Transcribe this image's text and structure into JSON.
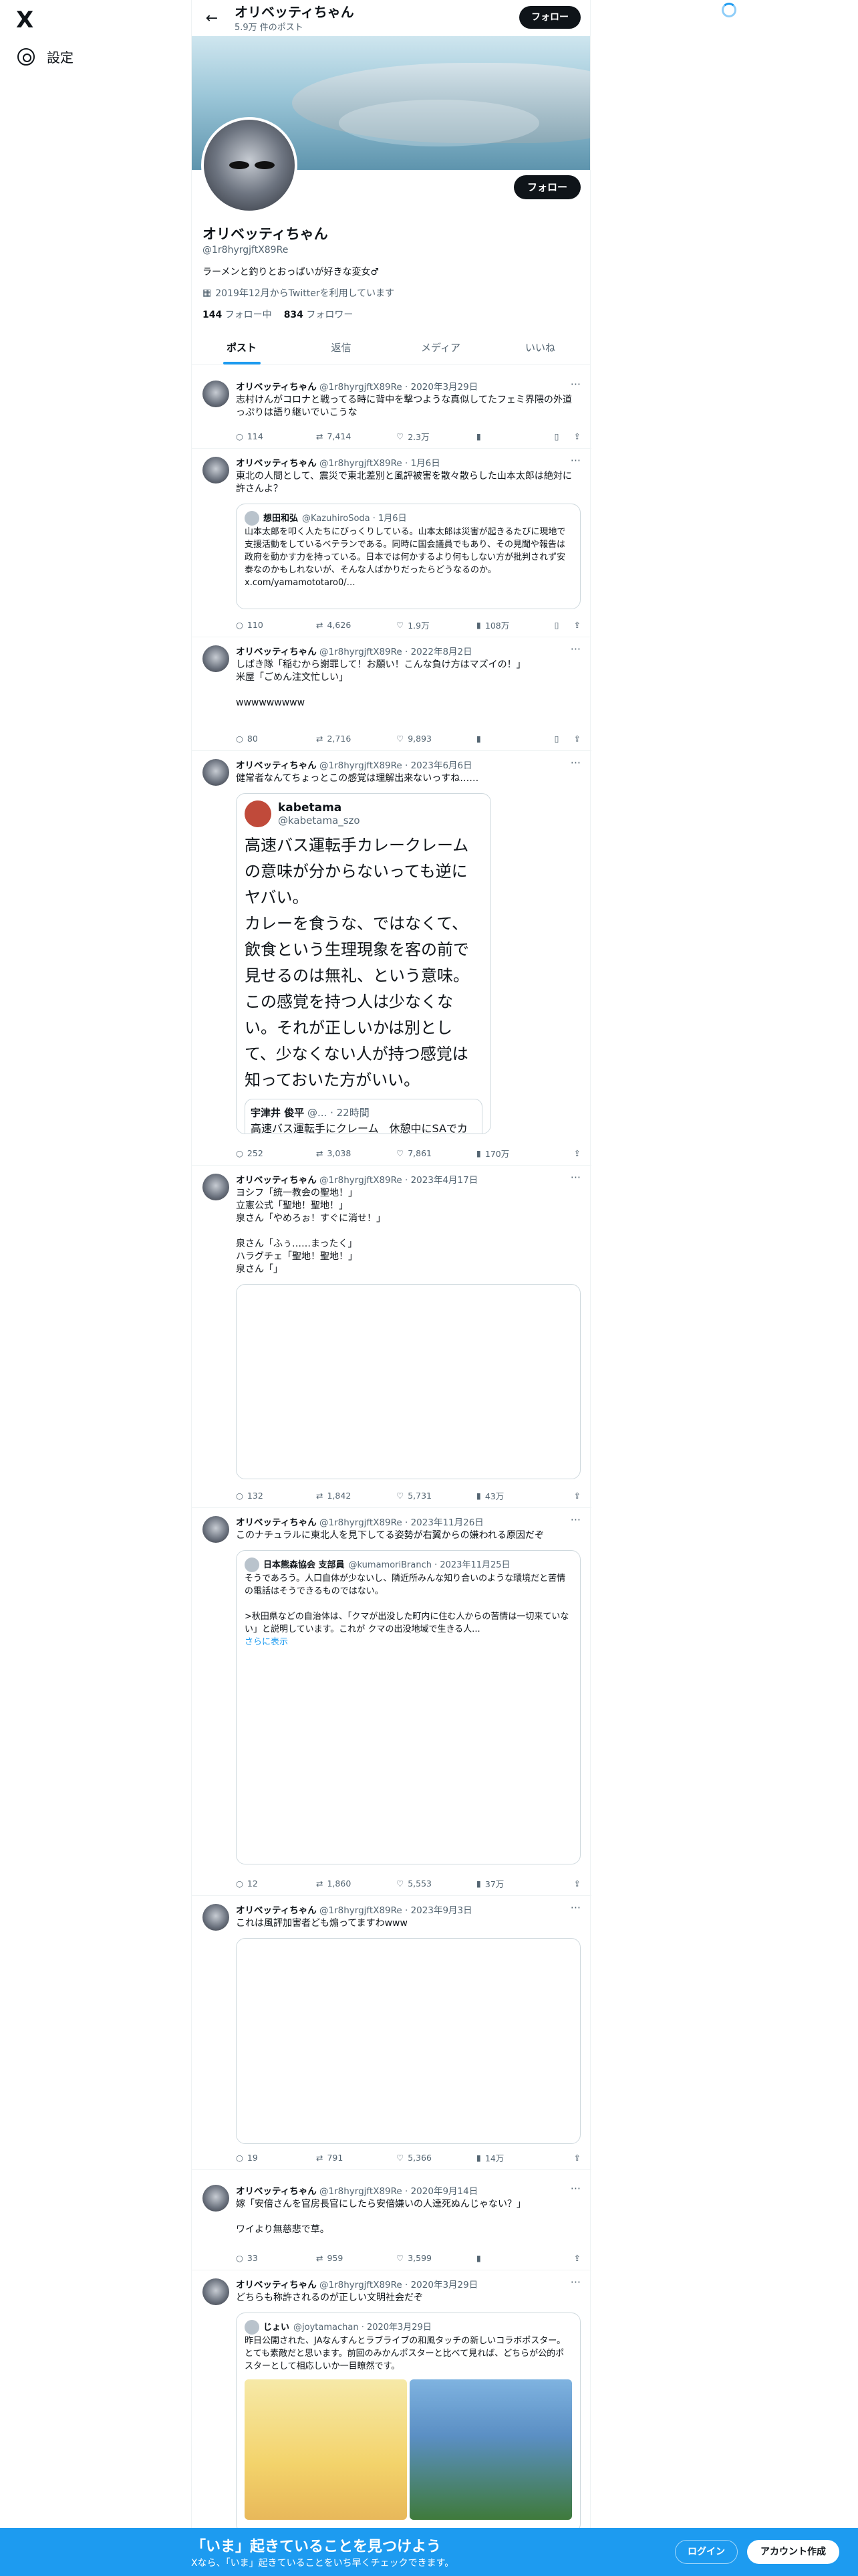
{
  "nav": {
    "logo": "X",
    "settings": "設定"
  },
  "header": {
    "name": "オリベッティちゃん",
    "posts": "5.9万 件のポスト",
    "follow": "フォロー"
  },
  "profile": {
    "name": "オリベッティちゃん",
    "handle": "@1r8hyrgjftX89Re",
    "bio": "ラーメンと釣りとおっぱいが好きな変女♂",
    "joined": "2019年12月からTwitterを利用しています",
    "following_count": "144",
    "following_label": "フォロー中",
    "followers_count": "834",
    "followers_label": "フォロワー",
    "follow": "フォロー"
  },
  "tabs": [
    "ポスト",
    "返信",
    "メディア",
    "いいね"
  ],
  "tweets": [
    {
      "name": "オリベッティちゃん",
      "meta": "@1r8hyrgjftX89Re · 2020年3月29日",
      "text": "志村けんがコロナと戦ってる時に背中を撃つような真似してたフェミ界隈の外道っぷりは語り継いでいこうな",
      "reply": "114",
      "rt": "7,414",
      "like": "2.3万",
      "views": ""
    },
    {
      "name": "オリベッティちゃん",
      "meta": "@1r8hyrgjftX89Re · 1月6日",
      "text": "東北の人間として、震災で東北差別と風評被害を散々散らした山本太郎は絶対に許さんよ？",
      "reply": "110",
      "rt": "4,626",
      "like": "1.9万",
      "views": "108万",
      "quote": {
        "name": "想田和弘",
        "meta": "@KazuhiroSoda · 1月6日",
        "text": "山本太郎を叩く人たちにびっくりしている。山本太郎は災害が起きるたびに現地で支援活動をしているベテランである。同時に国会議員でもあり、その見聞や報告は政府を動かす力を持っている。日本では何かするより何もしない方が批判されず安泰なのかもしれないが、そんな人ばかりだったらどうなるのか。x.com/yamamototaro0/…"
      }
    },
    {
      "name": "オリベッティちゃん",
      "meta": "@1r8hyrgjftX89Re · 2022年8月2日",
      "text": "しばき隊「稲むから謝罪して！お願い！こんな負け方はマズイの！」\n米屋「ごめん注文忙しい」\n\nwwwwwwwww",
      "reply": "80",
      "rt": "2,716",
      "like": "9,893",
      "views": ""
    },
    {
      "name": "オリベッティちゃん",
      "meta": "@1r8hyrgjftX89Re · 2023年6月6日",
      "text": "健常者なんてちょっとこの感覚は理解出来ないっすね……",
      "reply": "252",
      "rt": "3,038",
      "like": "7,861",
      "views": "170万",
      "embed": {
        "name": "kabetama",
        "handle": "@kabetama_szo",
        "text": "高速バス運転手カレークレームの意味が分からないっても逆にヤバい。\nカレーを食うな、ではなくて、飲食という生理現象を客の前で見せるのは無礼、という意味。\nこの感覚を持つ人は少なくない。それが正しいかは別として、少なくない人が持つ感覚は知っておいた方がいい。",
        "sub_name": "宇津井 俊平",
        "sub_meta": "@... · 22時間",
        "sub_text": "高速バス運転手にクレーム　休憩中にSAでカレーライス食べていただけなの"
      }
    },
    {
      "name": "オリベッティちゃん",
      "meta": "@1r8hyrgjftX89Re · 2023年4月17日",
      "text": "ヨシフ「統一教会の聖地！」\n立憲公式「聖地！聖地！」\n泉さん「やめろぉ！すぐに消せ！」\n\n泉さん「ふぅ……まったく」\nハラグチェ「聖地！聖地！」\n泉さん「」",
      "reply": "132",
      "rt": "1,842",
      "like": "5,731",
      "views": "43万"
    },
    {
      "name": "オリベッティちゃん",
      "meta": "@1r8hyrgjftX89Re · 2023年11月26日",
      "text": "このナチュラルに東北人を見下してる姿勢が右翼からの嫌われる原因だぞ",
      "reply": "12",
      "rt": "1,860",
      "like": "5,553",
      "views": "37万",
      "quote": {
        "name": "日本熊森協会 支部員",
        "meta": "@kumamoriBranch · 2023年11月25日",
        "text": "そうであろう。人口自体が少ないし、隣近所みんな知り合いのような環境だと苦情の電話はそうできるものではない。\n\n>秋田県などの自治体は、「クマが出没した町内に住む人からの苦情は一切来ていない」と説明しています。これが クマの出没地域で生きる人...",
        "more": "さらに表示"
      }
    },
    {
      "name": "オリベッティちゃん",
      "meta": "@1r8hyrgjftX89Re · 2023年9月3日",
      "text": "これは風評加害者ども煽ってますわwww",
      "reply": "19",
      "rt": "791",
      "like": "5,366",
      "views": "14万"
    },
    {
      "name": "オリベッティちゃん",
      "meta": "@1r8hyrgjftX89Re · 2020年9月14日",
      "text": "嫁「安倍さんを官房長官にしたら安倍嫌いの人達死ぬんじゃない？」\n\nワイより無慈悲で草。",
      "reply": "33",
      "rt": "959",
      "like": "3,599",
      "views": ""
    },
    {
      "name": "オリベッティちゃん",
      "meta": "@1r8hyrgjftX89Re · 2020年3月29日",
      "text": "どちらも称許されるのが正しい文明社会だぞ",
      "quote": {
        "name": "じょい",
        "meta": "@joytamachan · 2020年3月29日",
        "text": "昨日公開された、JAなんすんとラブライブの和風タッチの新しいコラボポスター。とても素敵だと思います。前回のみかんポスターと比べて見れば、どちらが公的ポスターとして相応しいか一目瞭然です。"
      }
    }
  ],
  "bottom": {
    "title": "「いま」起きていることを見つけよう",
    "sub": "Xなら、「いま」起きていることをいち早くチェックできます。",
    "login": "ログイン",
    "signup": "アカウント作成"
  }
}
